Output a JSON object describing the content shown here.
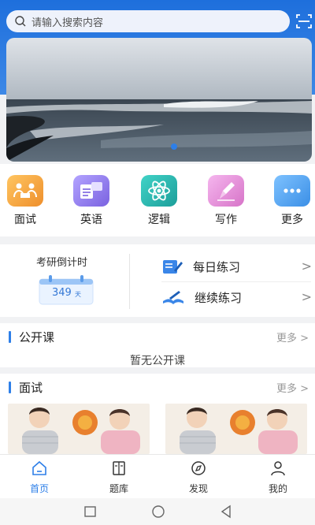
{
  "search": {
    "placeholder": "请输入搜索内容"
  },
  "categories": [
    {
      "label": "面试",
      "icon": "interview-icon",
      "color": "#f0a53a"
    },
    {
      "label": "英语",
      "icon": "english-icon",
      "color": "#8f7ae8"
    },
    {
      "label": "逻辑",
      "icon": "logic-atom-icon",
      "color": "#2ab7b0"
    },
    {
      "label": "写作",
      "icon": "writing-pen-icon",
      "color": "#e98bd0"
    },
    {
      "label": "更多",
      "icon": "more-dots-icon",
      "color": "#5aa8ee"
    }
  ],
  "countdown": {
    "title": "考研倒计时",
    "days": "349",
    "unit": "天"
  },
  "practice": [
    {
      "label": "每日练习",
      "chevron": ">"
    },
    {
      "label": "继续练习",
      "chevron": ">"
    }
  ],
  "open_course": {
    "title": "公开课",
    "more": "更多 >",
    "empty": "暂无公开课"
  },
  "interview": {
    "title": "面试",
    "more": "更多 >"
  },
  "tabs": [
    {
      "label": "首页",
      "icon": "home-icon",
      "active": true
    },
    {
      "label": "题库",
      "icon": "book-icon",
      "active": false
    },
    {
      "label": "发现",
      "icon": "compass-icon",
      "active": false
    },
    {
      "label": "我的",
      "icon": "user-icon",
      "active": false
    }
  ],
  "colors": {
    "accent": "#2e7fe8",
    "header": "#1e6fdc"
  }
}
